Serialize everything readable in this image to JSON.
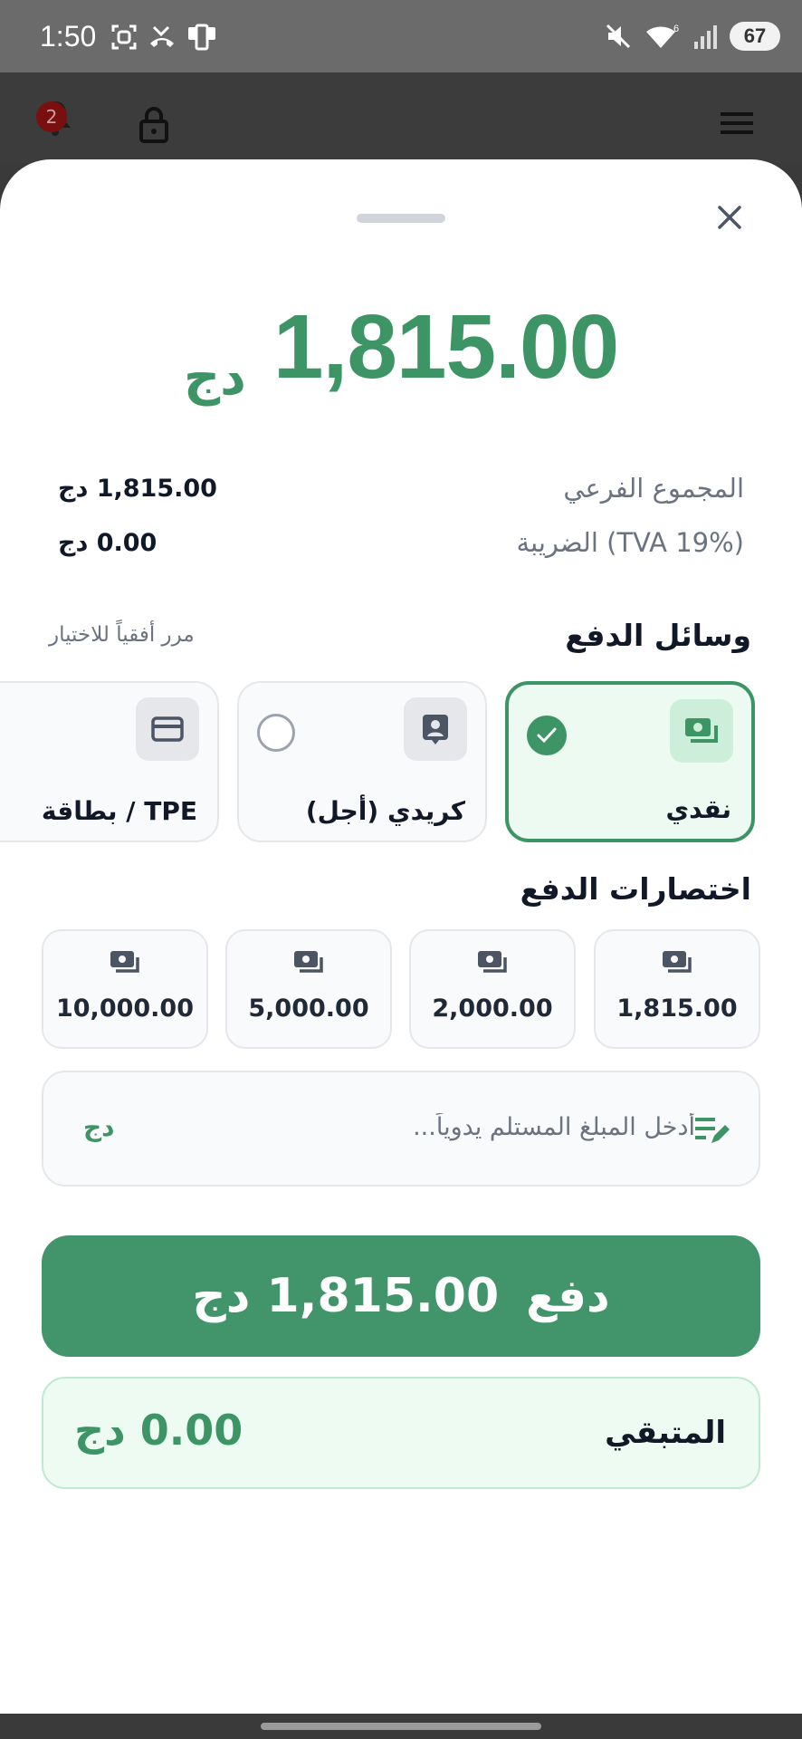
{
  "status_bar": {
    "time": "1:50",
    "battery": "67",
    "wifi_badge": "6"
  },
  "header": {
    "notification_count": "2"
  },
  "sheet": {
    "total_amount": "1,815.00",
    "total_currency": "دج",
    "summary": {
      "subtotal_label": "المجموع الفرعي",
      "subtotal_value": "1,815.00 دج",
      "tax_label": "الضريبة (TVA 19%)",
      "tax_value": "0.00 دج"
    },
    "payment_methods_title": "وسائل الدفع",
    "scroll_hint": "مرر أفقياً للاختيار",
    "methods": [
      {
        "label": "نقدي",
        "icon": "cash-icon",
        "selected": true
      },
      {
        "label": "كريدي (أجل)",
        "icon": "contact-card-icon",
        "selected": false
      },
      {
        "label": "بطاقة / TPE",
        "icon": "credit-card-icon",
        "selected": false
      }
    ],
    "shortcuts_title": "اختصارات الدفع",
    "shortcuts": [
      "1,815.00",
      "2,000.00",
      "5,000.00",
      "10,000.00"
    ],
    "manual_input": {
      "placeholder": "أدخل المبلغ المستلم يدوياً...",
      "value": "",
      "currency": "دج"
    },
    "pay_button": {
      "label": "دفع",
      "amount": "1,815.00 دج"
    },
    "remaining": {
      "label": "المتبقي",
      "value": "0.00 دج"
    }
  },
  "colors": {
    "accent": "#3d9465",
    "pay_button": "#42946a",
    "selected_card_bg": "#ecfaf1",
    "remaining_bg": "#edfbf3"
  }
}
